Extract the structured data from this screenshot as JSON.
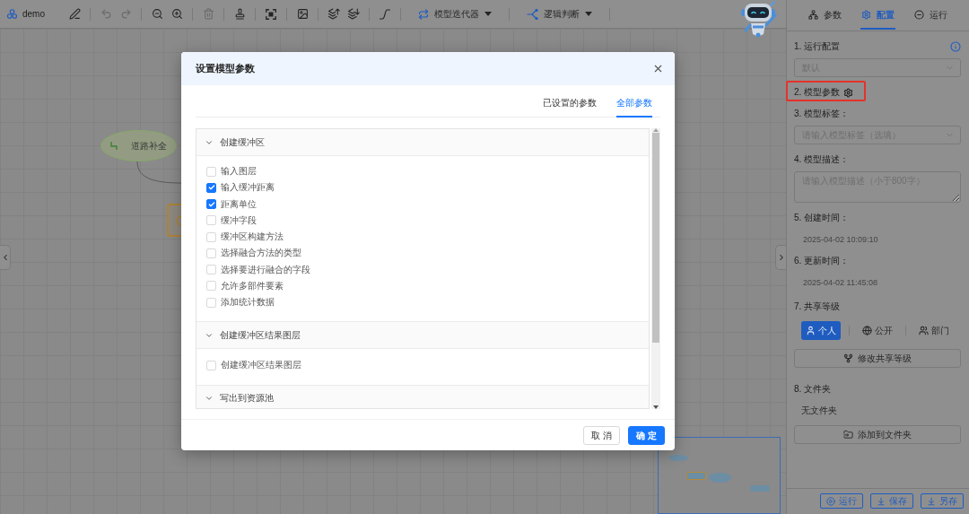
{
  "toolbar": {
    "project": "demo",
    "groups": [
      {
        "tools": [
          {
            "kind": "edit",
            "disabled": false
          }
        ]
      },
      {
        "tools": [
          {
            "kind": "undo",
            "disabled": true
          },
          {
            "kind": "redo",
            "disabled": true
          }
        ]
      },
      {
        "tools": [
          {
            "kind": "zoomout",
            "disabled": false
          },
          {
            "kind": "zoomin",
            "disabled": false
          }
        ]
      },
      {
        "tools": [
          {
            "kind": "delete",
            "disabled": true
          }
        ]
      },
      {
        "tools": [
          {
            "kind": "format",
            "disabled": false
          }
        ]
      },
      {
        "tools": [
          {
            "kind": "fit",
            "disabled": false
          }
        ]
      },
      {
        "tools": [
          {
            "kind": "image",
            "disabled": false
          }
        ]
      },
      {
        "tools": [
          {
            "kind": "raise",
            "disabled": false
          },
          {
            "kind": "lower",
            "disabled": false
          }
        ]
      },
      {
        "tools": [
          {
            "kind": "connector",
            "disabled": false
          }
        ]
      }
    ],
    "menus": [
      {
        "kind": "loop",
        "label": "模型迭代器"
      },
      {
        "kind": "branch",
        "label": "逻辑判断"
      }
    ]
  },
  "canvas": {
    "nodes": [
      {
        "kind": "step",
        "label": "道路补全"
      },
      {
        "kind": "process"
      }
    ]
  },
  "panel": {
    "tabs": [
      {
        "kind": "params",
        "label": "参数",
        "selected": false
      },
      {
        "kind": "config",
        "label": "配置",
        "selected": true
      },
      {
        "kind": "run",
        "label": "运行",
        "selected": false
      }
    ],
    "sections": [
      {
        "kind": "select",
        "title": "1. 运行配置",
        "info": true,
        "placeholder": "默认"
      },
      {
        "kind": "settings",
        "title": "2. 模型参数",
        "highlighted": true
      },
      {
        "kind": "select",
        "title": "3. 模型标签：",
        "placeholder": "请输入模型标签（选填）"
      },
      {
        "kind": "textarea",
        "title": "4. 模型描述：",
        "placeholder": "请输入模型描述（小于800字）"
      },
      {
        "kind": "text",
        "title": "5. 创建时间：",
        "value": "2025-04-02 10:09:10"
      },
      {
        "kind": "text",
        "title": "6. 更新时间：",
        "value": "2025-04-02 11:45:08"
      },
      {
        "kind": "share",
        "title": "7. 共享等级",
        "options": [
          {
            "kind": "personal",
            "label": "个人",
            "selected": true
          },
          {
            "kind": "public",
            "label": "公开",
            "selected": false
          },
          {
            "kind": "department",
            "label": "部门",
            "selected": false
          }
        ],
        "button": "修改共享等级"
      },
      {
        "kind": "folder",
        "title": "8. 文件夹",
        "value": "无文件夹",
        "button": "添加到文件夹"
      }
    ],
    "actions": [
      {
        "kind": "run",
        "label": "运行"
      },
      {
        "kind": "save",
        "label": "保存"
      },
      {
        "kind": "saveas",
        "label": "另存"
      }
    ]
  },
  "dialog": {
    "title": "设置模型参数",
    "tabs": [
      {
        "label": "已设置的参数",
        "selected": false
      },
      {
        "label": "全部参数",
        "selected": true
      }
    ],
    "groups": [
      {
        "title": "创建缓冲区",
        "expanded": true,
        "items": [
          {
            "label": "输入图层",
            "checked": false
          },
          {
            "label": "输入缓冲距离",
            "checked": true
          },
          {
            "label": "距离单位",
            "checked": true
          },
          {
            "label": "缓冲字段",
            "checked": false
          },
          {
            "label": "缓冲区构建方法",
            "checked": false
          },
          {
            "label": "选择融合方法的类型",
            "checked": false
          },
          {
            "label": "选择要进行融合的字段",
            "checked": false
          },
          {
            "label": "允许多部件要素",
            "checked": false
          },
          {
            "label": "添加统计数据",
            "checked": false
          }
        ]
      },
      {
        "title": "创建缓冲区结果图层",
        "expanded": true,
        "items": [
          {
            "label": "创建缓冲区结果图层",
            "checked": false
          }
        ]
      },
      {
        "title": "写出到资源池",
        "expanded": true
      }
    ],
    "buttons": [
      {
        "kind": "cancel",
        "label": "取 消"
      },
      {
        "kind": "primary",
        "label": "确 定"
      }
    ]
  }
}
